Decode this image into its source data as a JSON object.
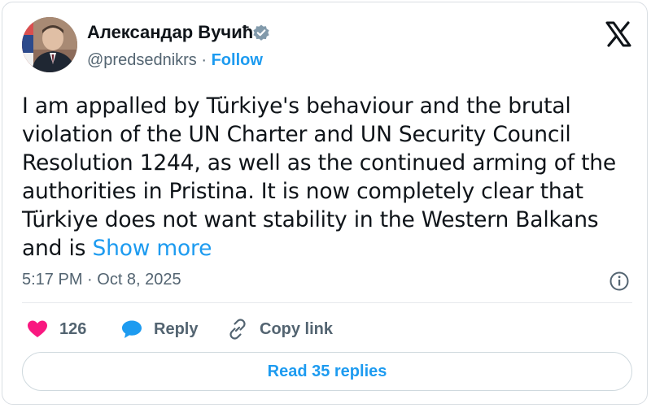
{
  "author": {
    "name": "Александар Вучић",
    "handle": "@predsednikrs",
    "separator": " · ",
    "follow_label": "Follow"
  },
  "tweet": {
    "text": "I am appalled by Türkiye's behaviour and the brutal violation of the UN Charter and UN Security Council Resolution 1244, as well as the continued arming of the authorities in Pristina. It is now completely clear that Türkiye does not want stability in the Western Balkans and is ",
    "show_more_label": "Show more"
  },
  "meta": {
    "timestamp": "5:17 PM · Oct 8, 2025"
  },
  "actions": {
    "like_count": "126",
    "reply_label": "Reply",
    "copy_link_label": "Copy link"
  },
  "read_replies_label": "Read 35 replies",
  "colors": {
    "accent": "#1d9bf0",
    "like": "#f91880",
    "text": "#0f1419",
    "muted": "#536471"
  },
  "icons": [
    "verified-badge-icon",
    "x-logo-icon",
    "info-icon",
    "heart-icon",
    "reply-bubble-icon",
    "link-icon"
  ]
}
